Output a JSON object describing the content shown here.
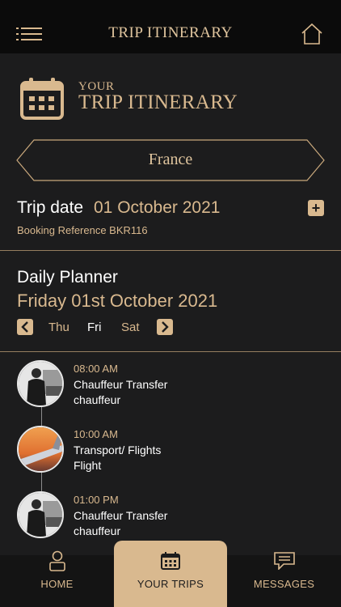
{
  "header": {
    "title": "TRIP ITINERARY"
  },
  "hero": {
    "your": "YOUR",
    "title": "TRIP ITINERARY"
  },
  "country": "France",
  "trip": {
    "date_label": "Trip date",
    "date_value": "01 October 2021",
    "add_symbol": "+",
    "booking_reference": "Booking Reference BKR116"
  },
  "planner": {
    "title": "Daily Planner",
    "date": "Friday 01st October 2021",
    "days": [
      "Thu",
      "Fri",
      "Sat"
    ],
    "selected_day": "Fri"
  },
  "events": [
    {
      "time": "08:00 AM",
      "title": "Chauffeur Transfer",
      "subtitle": "chauffeur",
      "icon": "chauffeur-photo"
    },
    {
      "time": "10:00 AM",
      "title": "Transport/ Flights",
      "subtitle": "Flight",
      "icon": "airplane-wing-photo"
    },
    {
      "time": "01:00 PM",
      "title": "Chauffeur Transfer",
      "subtitle": "chauffeur",
      "icon": "chauffeur-photo"
    }
  ],
  "nav": {
    "home": "HOME",
    "trips": "YOUR TRIPS",
    "messages": "MESSAGES",
    "active": "YOUR TRIPS"
  },
  "colors": {
    "accent": "#d9b98f",
    "background": "#1c1c1d",
    "topbar": "#0b0b0b"
  }
}
